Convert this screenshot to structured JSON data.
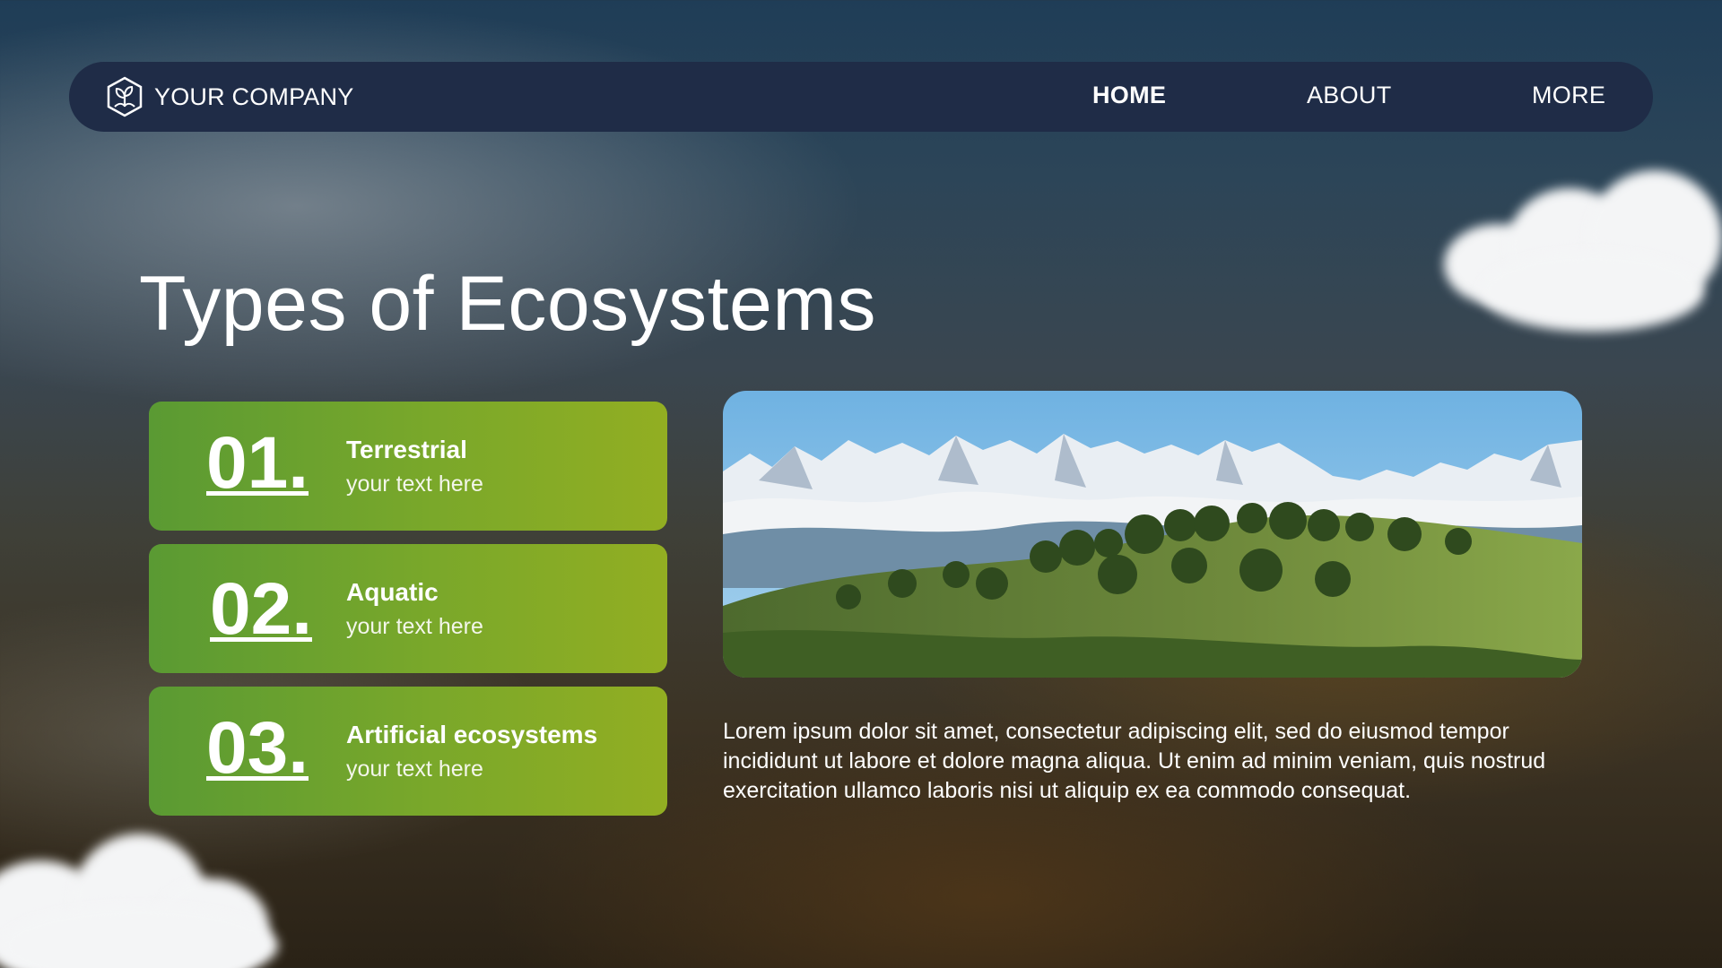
{
  "nav": {
    "brand_name": "YOUR COMPANY",
    "brand_logo_icon": "leaf-hexagon-icon",
    "links": [
      {
        "label": "HOME",
        "active": true
      },
      {
        "label": "ABOUT",
        "active": false
      },
      {
        "label": "MORE",
        "active": false
      }
    ],
    "bar_color": "#1f2c47"
  },
  "page": {
    "title": "Types of Ecosystems"
  },
  "cards": [
    {
      "number": "01.",
      "title": "Terrestrial",
      "subtitle": "your text here"
    },
    {
      "number": "02.",
      "title": "Aquatic",
      "subtitle": "your text here"
    },
    {
      "number": "03.",
      "title": "Artificial ecosystems",
      "subtitle": "your text here"
    }
  ],
  "card_colors": {
    "start": "#5a9a33",
    "end": "#92ae22"
  },
  "body_text": "Lorem ipsum dolor sit amet, consectetur adipiscing elit, sed do eiusmod tempor incididunt ut labore et dolore magna aliqua. Ut enim ad minim veniam, quis nostrud exercitation ullamco laboris nisi ut aliquip ex ea commodo consequat."
}
